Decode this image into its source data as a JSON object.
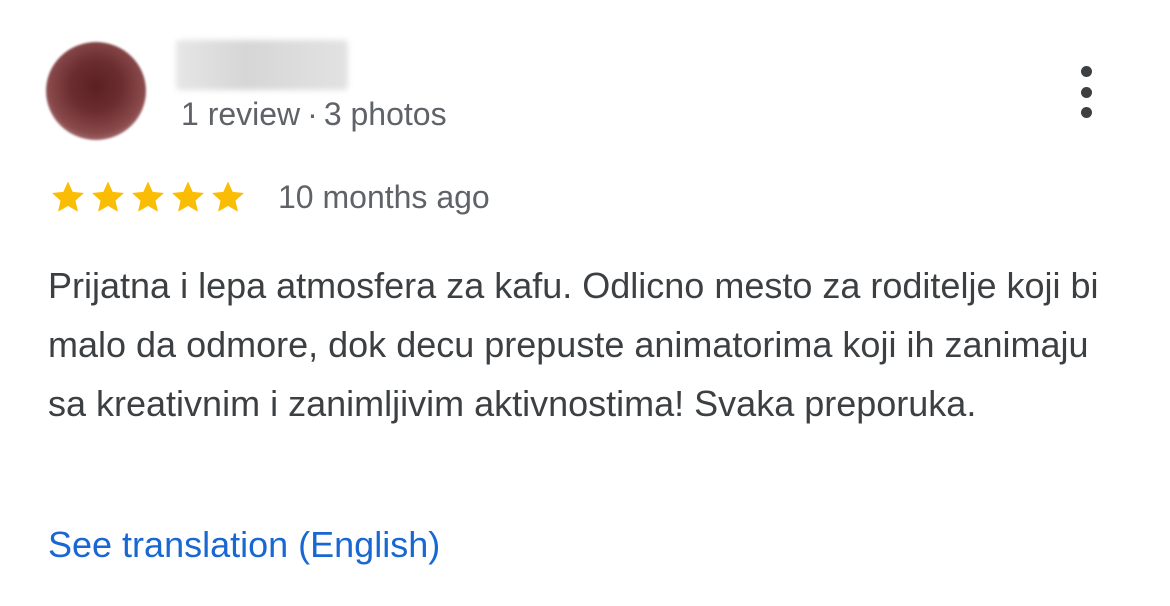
{
  "reviewer": {
    "meta_reviews": "1 review",
    "meta_separator": "·",
    "meta_photos": "3 photos"
  },
  "rating": {
    "stars": 5,
    "max_stars": 5,
    "star_color": "#fbbc04",
    "date": "10 months ago"
  },
  "review": {
    "text": "Prijatna i lepa atmosfera za kafu. Odlicno mesto za roditelje koji bi malo da odmore, dok decu prepuste animatorima koji ih zanimaju sa kreativnim i zanimljivim aktivnostima! Svaka preporuka."
  },
  "actions": {
    "translate_label": "See translation (English)",
    "more_icon": "more-vert-icon"
  },
  "colors": {
    "link": "#1967d2",
    "secondary_text": "#5f6368",
    "body_text": "#3c4043"
  }
}
